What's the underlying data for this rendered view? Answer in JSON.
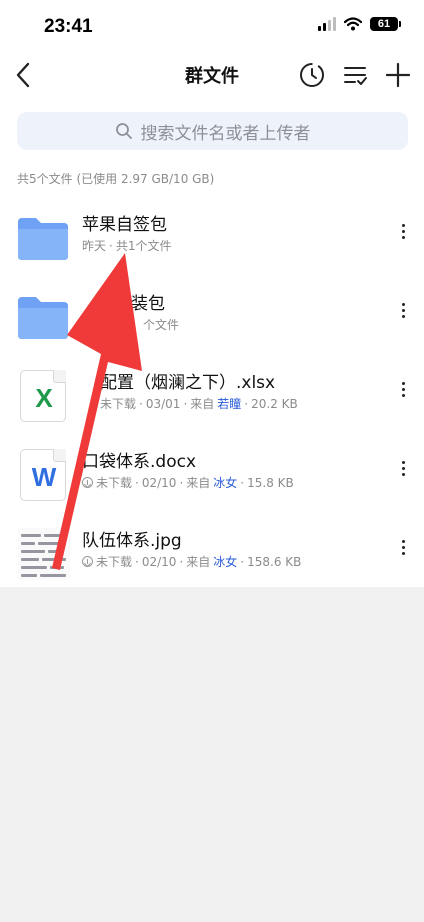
{
  "status_bar": {
    "time": "23:41",
    "battery": "61"
  },
  "nav": {
    "title": "群文件"
  },
  "search": {
    "placeholder": "搜索文件名或者上传者"
  },
  "summary": "共5个文件 (已使用 2.97 GB/10 GB)",
  "files": [
    {
      "name": "苹果自签包",
      "meta_date": "昨天",
      "meta_extra": "共1个文件",
      "icon": "folder-icon"
    },
    {
      "name": "装包",
      "meta_extra": "个文件",
      "icon": "folder-icon"
    },
    {
      "name": "配置（烟澜之下）.xlsx",
      "status": "未下载",
      "date": "03/01",
      "from": "来自",
      "user": "若瞳",
      "size": "20.2 KB",
      "icon": "excel-icon",
      "icon_letter": "X"
    },
    {
      "name": "口袋体系.docx",
      "status": "未下载",
      "date": "02/10",
      "from": "来自",
      "user": "冰女",
      "size": "15.8 KB",
      "icon": "word-icon",
      "icon_letter": "W"
    },
    {
      "name": "队伍体系.jpg",
      "status": "未下载",
      "date": "02/10",
      "from": "来自",
      "user": "冰女",
      "size": "158.6 KB",
      "icon": "image-thumbnail"
    }
  ],
  "colors": {
    "folder": "#6fa2f5",
    "excel": "#1f9a4a",
    "word": "#2f6fe0",
    "link": "#2a5bd7",
    "annotation_arrow": "#f03a3a"
  }
}
